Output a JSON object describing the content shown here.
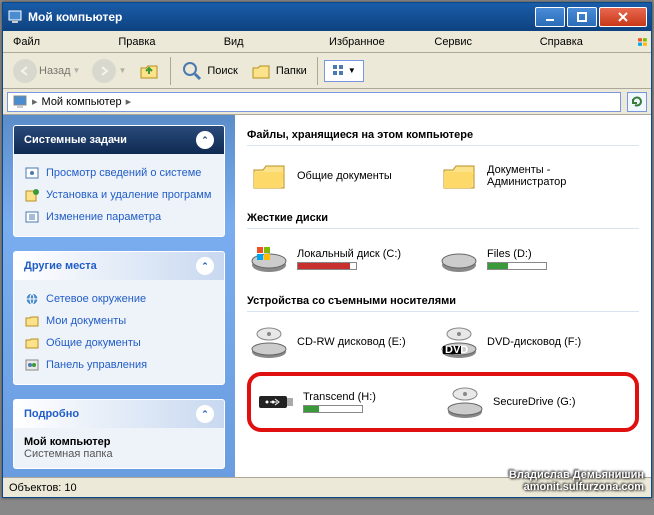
{
  "window": {
    "title": "Мой компьютер"
  },
  "menu": {
    "file": "Файл",
    "edit": "Правка",
    "view": "Вид",
    "favorites": "Избранное",
    "tools": "Сервис",
    "help": "Справка"
  },
  "toolbar": {
    "back": "Назад",
    "search": "Поиск",
    "folders": "Папки"
  },
  "address": {
    "path": "Мой компьютер"
  },
  "sidebar": {
    "tasks": {
      "title": "Системные задачи",
      "items": [
        "Просмотр сведений о системе",
        "Установка и удаление программ",
        "Изменение параметра"
      ]
    },
    "places": {
      "title": "Другие места",
      "items": [
        "Сетевое окружение",
        "Мои документы",
        "Общие документы",
        "Панель управления"
      ]
    },
    "details": {
      "title": "Подробно",
      "name": "Мой компьютер",
      "type": "Системная папка"
    }
  },
  "content": {
    "group1": {
      "title": "Файлы, хранящиеся на этом компьютере",
      "items": [
        "Общие документы",
        "Документы - Администратор"
      ]
    },
    "group2": {
      "title": "Жесткие диски",
      "items": [
        "Локальный диск (C:)",
        "Files (D:)"
      ]
    },
    "group3": {
      "title": "Устройства со съемными носителями",
      "items": [
        "CD-RW дисковод (E:)",
        "DVD-дисковод (F:)",
        "Transcend (H:)",
        "SecureDrive (G:)"
      ]
    }
  },
  "status": {
    "objects": "Объектов: 10"
  },
  "watermark": {
    "line1": "Владислав Демьянишин",
    "line2": "amonit.sulfurzona.com"
  }
}
